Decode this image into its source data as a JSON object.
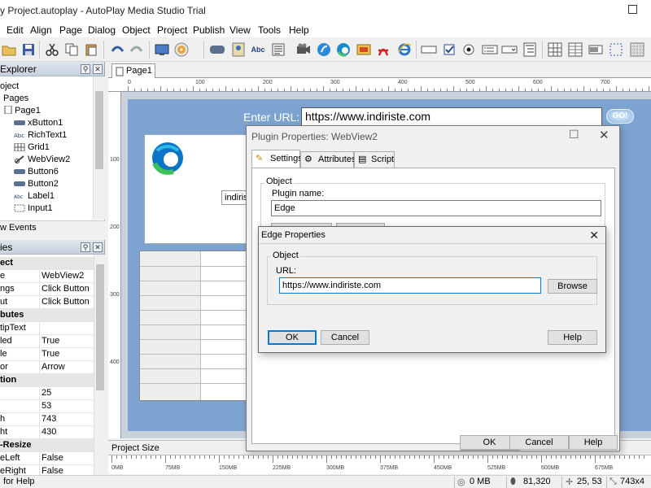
{
  "window": {
    "title": "y Project.autoplay - AutoPlay Media Studio Trial"
  },
  "menu": [
    "Edit",
    "Align",
    "Page",
    "Dialog",
    "Object",
    "Project",
    "Publish",
    "View",
    "Tools",
    "Help"
  ],
  "toolbar_icons": [
    "open-folder-icon",
    "save-icon",
    "cut-icon",
    "copy-icon",
    "paste-icon",
    "undo-icon",
    "redo-icon",
    "preview-icon",
    "build-cd-icon",
    "button-object-icon",
    "image-object-icon",
    "label-text-icon",
    "paragraph-icon",
    "video-icon",
    "flash-icon",
    "edge-icon",
    "slideshow-icon",
    "pdf-icon",
    "ie-icon",
    "input-icon",
    "checkbox-icon",
    "radio-icon",
    "listbox-icon",
    "combobox-icon",
    "tree-icon",
    "grid-icon",
    "progress-icon",
    "snap-grid-icon",
    "show-grid-icon"
  ],
  "explorer": {
    "title": "Explorer",
    "items": [
      {
        "label": "oject",
        "icon": "project-icon"
      },
      {
        "label": "Pages",
        "icon": "pages-icon"
      },
      {
        "label": "Page1",
        "icon": "page-icon"
      },
      {
        "label": "xButton1",
        "icon": "xbutton-icon"
      },
      {
        "label": "RichText1",
        "icon": "richtext-icon"
      },
      {
        "label": "Grid1",
        "icon": "grid-object-icon"
      },
      {
        "label": "WebView2",
        "icon": "webview-icon"
      },
      {
        "label": "Button6",
        "icon": "button-icon"
      },
      {
        "label": "Button2",
        "icon": "button-icon"
      },
      {
        "label": "Label1",
        "icon": "label-icon"
      },
      {
        "label": "Input1",
        "icon": "input-object-icon"
      }
    ],
    "view_events": "w Events"
  },
  "properties": {
    "title": "ies",
    "rows": [
      {
        "type": "cat",
        "k": "ect"
      },
      {
        "type": "row",
        "k": "e",
        "v": "WebView2"
      },
      {
        "type": "row",
        "k": "ngs",
        "v": "Click Button"
      },
      {
        "type": "row",
        "k": "ut",
        "v": "Click Button"
      },
      {
        "type": "cat",
        "k": "butes"
      },
      {
        "type": "row",
        "k": "tipText",
        "v": ""
      },
      {
        "type": "row",
        "k": "led",
        "v": "True"
      },
      {
        "type": "row",
        "k": "le",
        "v": "True"
      },
      {
        "type": "row",
        "k": "or",
        "v": "Arrow"
      },
      {
        "type": "cat",
        "k": "tion"
      },
      {
        "type": "row",
        "k": "",
        "v": "25"
      },
      {
        "type": "row",
        "k": "",
        "v": "53"
      },
      {
        "type": "row",
        "k": "h",
        "v": "743"
      },
      {
        "type": "row",
        "k": "ht",
        "v": "430"
      },
      {
        "type": "cat",
        "k": "-Resize"
      },
      {
        "type": "row",
        "k": "eLeft",
        "v": "False"
      },
      {
        "type": "row",
        "k": "eRight",
        "v": "False"
      }
    ]
  },
  "workspace": {
    "tab": "Page1",
    "hruler": [
      "0",
      "100",
      "200",
      "300",
      "400",
      "500",
      "600",
      "700"
    ],
    "vruler": [
      "100",
      "200",
      "300",
      "400"
    ],
    "enter_url_label": "Enter URL:",
    "url_value": "https://www.indiriste.com",
    "go_label": "GO!",
    "inner_input": "indiris",
    "project_size": "Project Size",
    "size_ruler": [
      "0MB",
      "75MB",
      "150MB",
      "225MB",
      "300MB",
      "375MB",
      "450MB",
      "525MB",
      "600MB",
      "675MB"
    ]
  },
  "plugin_dialog": {
    "title": "Plugin Properties: WebView2",
    "tabs": [
      "Settings",
      "Attributes",
      "Script"
    ],
    "group": "Object",
    "plugin_name_label": "Plugin name:",
    "plugin_name": "Edge",
    "ok": "OK",
    "cancel": "Cancel",
    "help": "Help"
  },
  "edge_dialog": {
    "title": "Edge Properties",
    "group": "Object",
    "url_label": "URL:",
    "url_value": "https://www.indiriste.com",
    "browse": "Browse",
    "ok": "OK",
    "cancel": "Cancel",
    "help": "Help"
  },
  "status": {
    "help": "for Help",
    "memory": "0 MB",
    "size": "81,320",
    "coords": "25, 53",
    "dims": "743x4"
  },
  "colors": {
    "accent": "#0078d7",
    "page_bg": "#7da4d1"
  }
}
